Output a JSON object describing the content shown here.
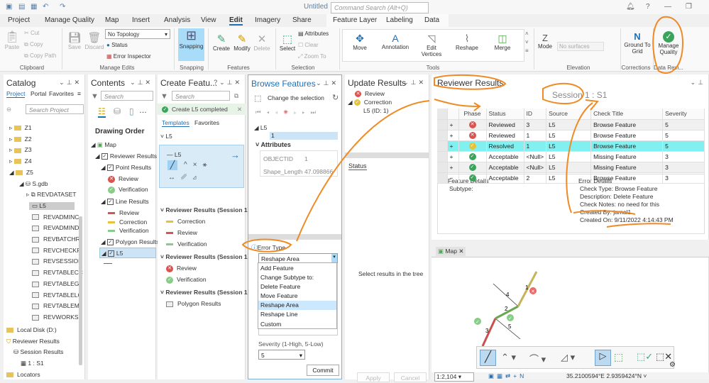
{
  "app": {
    "title": "Untitled",
    "command_search_placeholder": "Command Search (Alt+Q)"
  },
  "tabs": [
    "Project",
    "Manage Quality",
    "Map",
    "Insert",
    "Analysis",
    "View",
    "Edit",
    "Imagery",
    "Share",
    "Feature Layer",
    "Labeling",
    "Data"
  ],
  "active_tab": "Edit",
  "ribbon": {
    "clipboard": {
      "paste": "Paste",
      "cut": "Cut",
      "copy": "Copy",
      "copy_path": "Copy Path",
      "group": "Clipboard"
    },
    "manage_edits": {
      "save": "Save",
      "discard": "Discard",
      "topology": "No Topology",
      "status": "Status",
      "error_inspector": "Error Inspector",
      "group": "Manage Edits"
    },
    "snapping": {
      "label": "Snapping",
      "group": "Snapping"
    },
    "features": {
      "create": "Create",
      "modify": "Modify",
      "delete": "Delete",
      "group": "Features"
    },
    "selection": {
      "select": "Select",
      "attributes": "Attributes",
      "clear": "Clear",
      "zoom_to": "Zoom To",
      "group": "Selection"
    },
    "tools": {
      "move": "Move",
      "annotation": "Annotation",
      "edit_vertices": "Edit Vertices",
      "reshape": "Reshape",
      "merge": "Merge",
      "group": "Tools"
    },
    "elevation": {
      "mode": "Mode",
      "surface": "No surfaces",
      "group": "Elevation"
    },
    "corrections": {
      "ground_to_grid": "Ground To Grid",
      "group": "Corrections"
    },
    "data_reviewer": {
      "manage_quality": "Manage Quality",
      "group": "Data Revi..."
    }
  },
  "catalog": {
    "title": "Catalog",
    "tabs": [
      "Project",
      "Portal",
      "Favorites"
    ],
    "search_placeholder": "Search Project",
    "items": [
      {
        "label": "Z1",
        "type": "folder"
      },
      {
        "label": "Z2",
        "type": "folder"
      },
      {
        "label": "Z3",
        "type": "folder"
      },
      {
        "label": "Z4",
        "type": "folder"
      },
      {
        "label": "Z5",
        "type": "folder"
      },
      {
        "label": "S.gdb",
        "type": "gdb"
      },
      {
        "label": "REVDATASET",
        "type": "dataset"
      },
      {
        "label": "L5",
        "type": "fc"
      },
      {
        "label": "REVADMINC",
        "type": "table"
      },
      {
        "label": "REVADMIND",
        "type": "table"
      },
      {
        "label": "REVBATCHR",
        "type": "table"
      },
      {
        "label": "REVCHECKR",
        "type": "table"
      },
      {
        "label": "REVSESSION",
        "type": "table"
      },
      {
        "label": "REVTABLECC",
        "type": "table"
      },
      {
        "label": "REVTABLEGI",
        "type": "table"
      },
      {
        "label": "REVTABLELC",
        "type": "table"
      },
      {
        "label": "REVTABLEM",
        "type": "table"
      },
      {
        "label": "REVWORKSP",
        "type": "table"
      },
      {
        "label": "Local Disk (D:)",
        "type": "folder"
      },
      {
        "label": "Reviewer Results",
        "type": "rev"
      },
      {
        "label": "Session Results",
        "type": "session"
      },
      {
        "label": "1 : S1",
        "type": "s1"
      },
      {
        "label": "Locators",
        "type": "folder"
      }
    ]
  },
  "contents": {
    "title": "Contents",
    "search_placeholder": "Search",
    "drawing_order": "Drawing Order",
    "map": "Map",
    "reviewer_results": "Reviewer Results (",
    "point_results": "Point Results",
    "point_items": [
      "Review",
      "Verification"
    ],
    "line_results": "Line Results",
    "line_items": [
      "Review",
      "Correction",
      "Verification"
    ],
    "polygon_results": "Polygon Results",
    "l5": "L5"
  },
  "create_features": {
    "title": "Create Featu...",
    "search_placeholder": "Search",
    "banner": "Create L5 completed",
    "tabs": [
      "Templates",
      "Favorites"
    ],
    "group_l5": "L5",
    "template": "L5",
    "groups": [
      {
        "label": "Reviewer Results (Session 1 :",
        "items": [
          "Correction",
          "Review",
          "Verification"
        ]
      },
      {
        "label": "Reviewer Results (Session 1",
        "items": [
          "Review",
          "Verification"
        ]
      },
      {
        "label": "Reviewer Results (Session 1 :",
        "items": [
          "Polygon Results"
        ]
      }
    ]
  },
  "browse_features": {
    "title": "Browse Features",
    "change_selection": "Change the selection",
    "layer": "L5",
    "selected": "1",
    "attributes_label": "Attributes",
    "attributes": [
      {
        "name": "OBJECTID",
        "value": "1"
      },
      {
        "name": "Shape_Length",
        "value": "47.098866"
      }
    ],
    "error_type_label": "Error Type",
    "error_type_value": "Reshape Area",
    "error_type_options": [
      "Add Feature",
      "Change Subtype to:",
      "Delete Feature",
      "Move Feature",
      "Reshape Area",
      "Reshape Line",
      "Custom"
    ],
    "severity_label": "Severity (1-High, 5-Low)",
    "severity_value": "5",
    "commit": "Commit"
  },
  "update_results": {
    "title": "Update Results",
    "tree": [
      "Review",
      "Correction",
      "L5 (ID: 1)"
    ],
    "status_tab": "Status",
    "empty": "Select results in the tree",
    "apply": "Apply",
    "cancel": "Cancel"
  },
  "reviewer_results": {
    "title": "Reviewer Results",
    "session": "Session 1 : S1",
    "columns": [
      "Phase",
      "Status",
      "ID",
      "Source",
      "Check Title",
      "Severity"
    ],
    "rows": [
      {
        "exp": "+",
        "phase": "error",
        "status": "Reviewed",
        "id": "3",
        "source": "L5",
        "check": "Browse Feature",
        "severity": "5"
      },
      {
        "exp": "+",
        "phase": "error",
        "status": "Reviewed",
        "id": "1",
        "source": "L5",
        "check": "Browse Feature",
        "severity": "5"
      },
      {
        "exp": "+",
        "phase": "resolved",
        "status": "Resolved",
        "id": "1",
        "source": "L5",
        "check": "Browse Feature",
        "severity": "5"
      },
      {
        "exp": "+",
        "phase": "ok",
        "status": "Acceptable",
        "id": "<Null>",
        "source": "L5",
        "check": "Missing Feature",
        "severity": "3"
      },
      {
        "exp": "+",
        "phase": "ok",
        "status": "Acceptable",
        "id": "<Null>",
        "source": "L5",
        "check": "Missing Feature",
        "severity": "3"
      },
      {
        "exp": "−",
        "phase": "ok",
        "status": "Acceptable",
        "id": "2",
        "source": "L5",
        "check": "Browse Feature",
        "severity": "3"
      }
    ],
    "feature_details": {
      "title": "Feature Details",
      "subtype": "Subtype:"
    },
    "error_details": {
      "title": "Error Details",
      "check_type": "Check Type:  Browse Feature",
      "description": "Description:  Delete Feature",
      "check_notes": "Check Notes: no need for this",
      "created_by": "Created By:  jamal1",
      "created_on": "Created On:  9/11/2022 4:14:43 PM"
    }
  },
  "map": {
    "tab": "Map",
    "labels": [
      "1",
      "2",
      "3",
      "4",
      "5"
    ],
    "scale": "1:2,104",
    "coords": "35.2100594°E 2.9359424°N"
  },
  "colors": {
    "accent": "#1f6fb5",
    "annotation": "#f08a24",
    "selected_row": "#80f0f0",
    "error": "#d9534f",
    "ok": "#5cb85c",
    "resolved": "#e6c23a"
  }
}
